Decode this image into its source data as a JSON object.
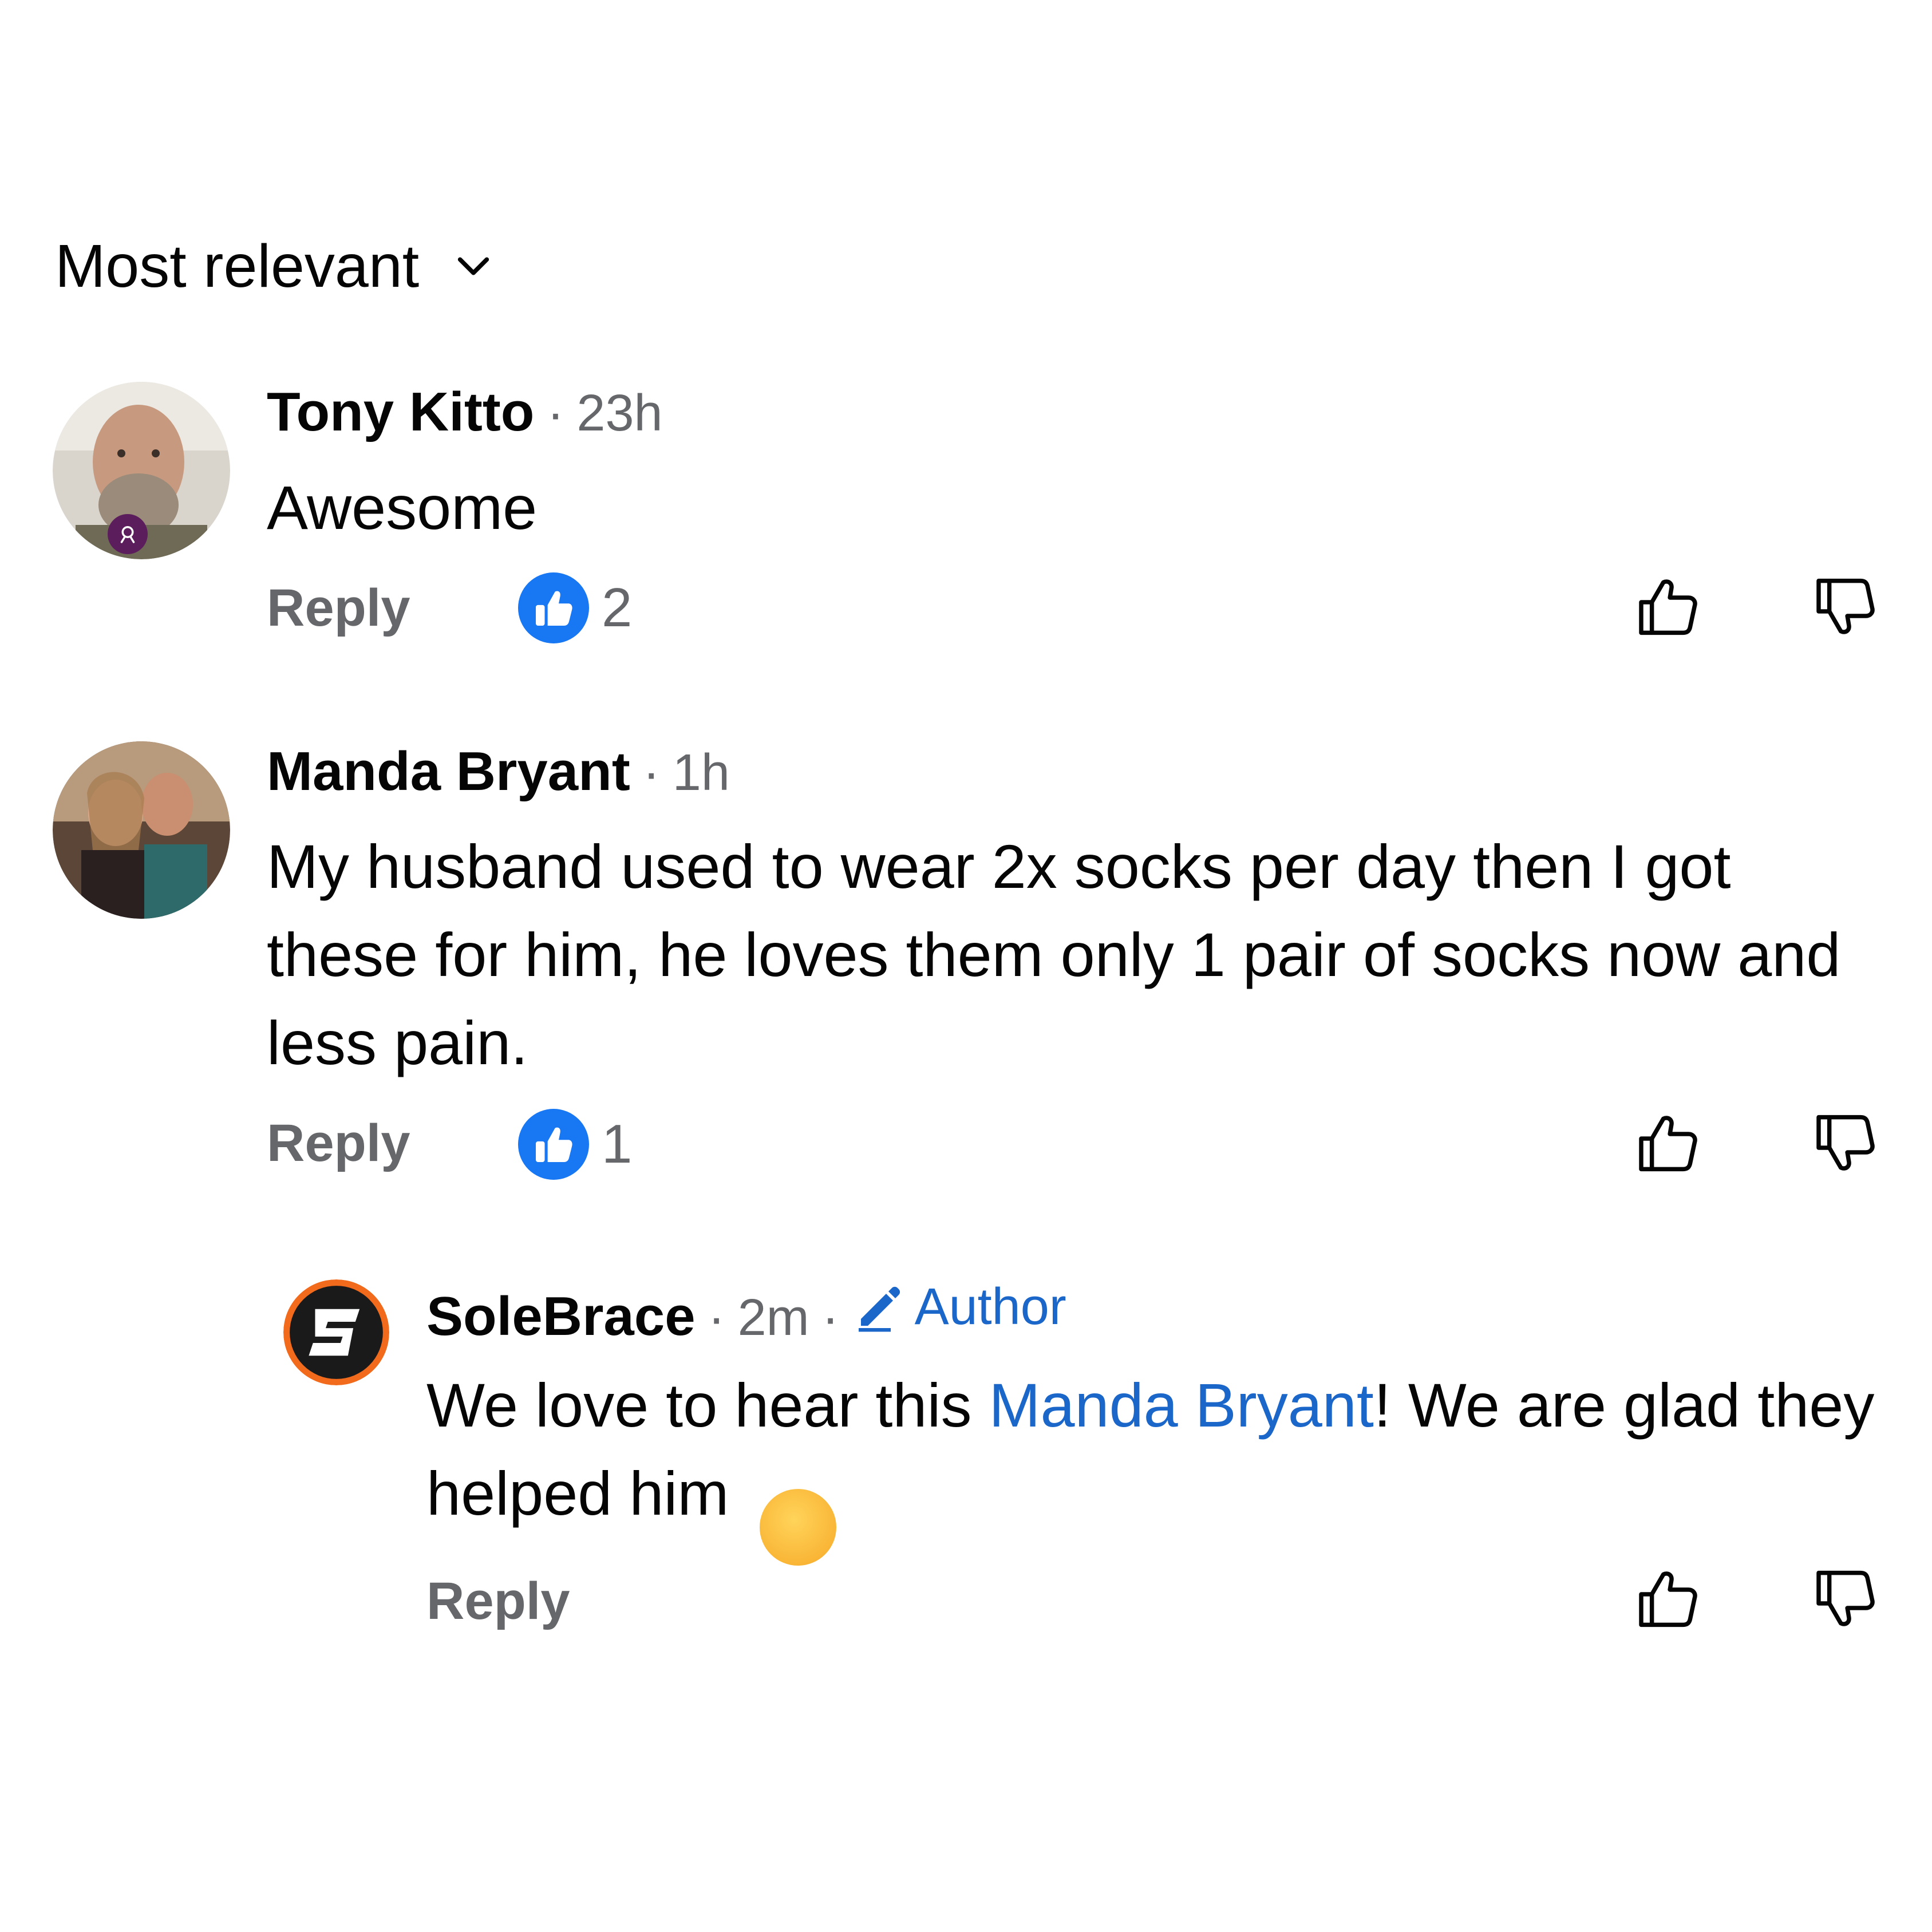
{
  "sort": {
    "label": "Most relevant",
    "icon": "chevron-down-icon"
  },
  "comments": [
    {
      "author": "Tony Kitto",
      "time": "23h",
      "text": "Awesome",
      "reply_label": "Reply",
      "reaction_count": "2",
      "avatar_badge_icon": "contributor-badge-icon"
    },
    {
      "author": "Manda Bryant",
      "time": "1h",
      "text": "My husband used to wear 2x socks per day then I got these for him, he loves them only 1 pair of socks now and less pain.",
      "reply_label": "Reply",
      "reaction_count": "1"
    }
  ],
  "reply": {
    "author": "SoleBrace",
    "time": "2m",
    "badge": "Author",
    "text_before": "We love to hear this ",
    "mention": "Manda Bryant",
    "text_after": "! We are glad they helped him",
    "emoji": "😊",
    "reply_label": "Reply"
  },
  "colors": {
    "link_blue": "#1b66c9",
    "like_blue": "#1877f2",
    "secondary_text": "#65676b",
    "brand_orange": "#f26b1d"
  }
}
